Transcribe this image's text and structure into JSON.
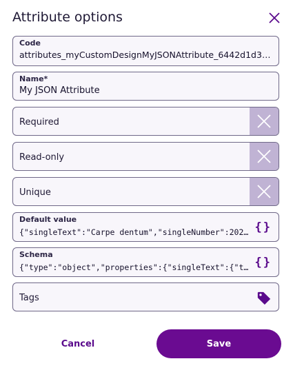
{
  "dialog": {
    "title": "Attribute options",
    "close_icon": "close-icon"
  },
  "fields": {
    "code": {
      "label": "Code",
      "value": "attributes_myCustomDesignMyJSONAttribute_6442d1d3352c0…"
    },
    "name": {
      "label": "Name*",
      "value": "My JSON Attribute"
    },
    "required": {
      "label": "Required",
      "state": "off",
      "icon": "x-icon"
    },
    "readonly": {
      "label": "Read-only",
      "state": "off",
      "icon": "x-icon"
    },
    "unique": {
      "label": "Unique",
      "state": "off",
      "icon": "x-icon"
    },
    "default_value": {
      "label": "Default value",
      "value": "{\"singleText\":\"Carpe dentum\",\"singleNumber\":2026,\"si…",
      "icon": "code-braces-icon"
    },
    "schema": {
      "label": "Schema",
      "value": "{\"type\":\"object\",\"properties\":{\"singleText\":{\"title\"…",
      "icon": "code-braces-icon"
    },
    "tags": {
      "label": "Tags",
      "icon": "tag-icon"
    }
  },
  "icons": {
    "braces_glyph": "{}"
  },
  "actions": {
    "cancel_label": "Cancel",
    "save_label": "Save"
  },
  "colors": {
    "accent": "#6a0b91",
    "toggle_bg": "#c0b3d4",
    "field_bg": "#f8f6fb"
  }
}
